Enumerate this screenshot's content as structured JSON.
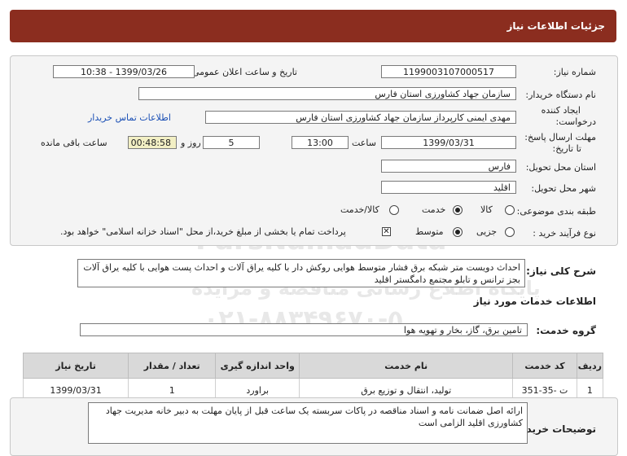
{
  "header": {
    "title": "جزئیات اطلاعات نیاز"
  },
  "form": {
    "need_number_label": "شماره نیاز:",
    "need_number": "1199003107000517",
    "announce_label": "تاریخ و ساعت اعلان عمومی:",
    "announce_value": "1399/03/26 - 10:38",
    "buyer_org_label": "نام دستگاه خریدار:",
    "buyer_org": "سازمان جهاد کشاورزی استان فارس",
    "creator_label_1": "ایجاد کننده",
    "creator_label_2": "درخواست:",
    "creator": "مهدی ایمنی کارپرداز سازمان جهاد کشاورزی استان فارس",
    "contact_link": "اطلاعات تماس خریدار",
    "deadline_label_1": "مهلت ارسال پاسخ:",
    "deadline_label_2": "تا تاریخ:",
    "deadline_date": "1399/03/31",
    "time_label": "ساعت",
    "deadline_time": "13:00",
    "days_value": "5",
    "days_label": "روز و",
    "remaining_time": "00:48:58",
    "remaining_label": "ساعت باقی مانده",
    "province_label": "استان محل تحویل:",
    "province": "فارس",
    "city_label": "شهر محل تحویل:",
    "city": "اقلید",
    "category_label": "طبقه بندی موضوعی:",
    "category_options": [
      "کالا",
      "خدمت",
      "کالا/خدمت"
    ],
    "category_selected": "خدمت",
    "process_label": "نوع فرآیند خرید :",
    "process_options": [
      "جزیی",
      "متوسط"
    ],
    "process_selected": "متوسط",
    "payment_note": "پرداخت تمام یا بخشی از مبلغ خرید،از محل \"اسناد خزانه اسلامی\" خواهد بود."
  },
  "description": {
    "label": "شرح کلی نیاز:",
    "text": "احداث دویست متر شبکه برق فشار متوسط هوایی روکش دار با کلیه یراق آلات و احداث پست هوایی با کلیه یراق آلات بجز ترانس و تابلو مجتمع دامگستر اقلید"
  },
  "services": {
    "section_title": "اطلاعات خدمات مورد نیاز",
    "group_label": "گروه خدمت:",
    "group_value": "تامین برق، گاز، بخار و تهویه هوا",
    "columns": [
      "ردیف",
      "کد خدمت",
      "نام خدمت",
      "واحد اندازه گیری",
      "تعداد / مقدار",
      "تاریخ نیاز"
    ],
    "rows": [
      [
        "1",
        "ت -35-351",
        "تولید، انتقال و توزیع برق",
        "براورد",
        "1",
        "1399/03/31"
      ]
    ]
  },
  "buyer_notes": {
    "label": "توضیحات خریدار:",
    "text": "ارائه اصل ضمانت نامه و اسناد مناقصه  در پاکات سربسته یک ساعت قبل از پایان مهلت به دبیر خانه مدیریت جهاد کشاورزی اقلید الزامی است"
  },
  "watermark": {
    "line1": "ParsNamadData",
    "line2": "پایگاه اطلاع رسانی مناقصه و مزایده",
    "line3": "۰۲۱-۸۸۳۴۹۶۷۰-۵"
  }
}
